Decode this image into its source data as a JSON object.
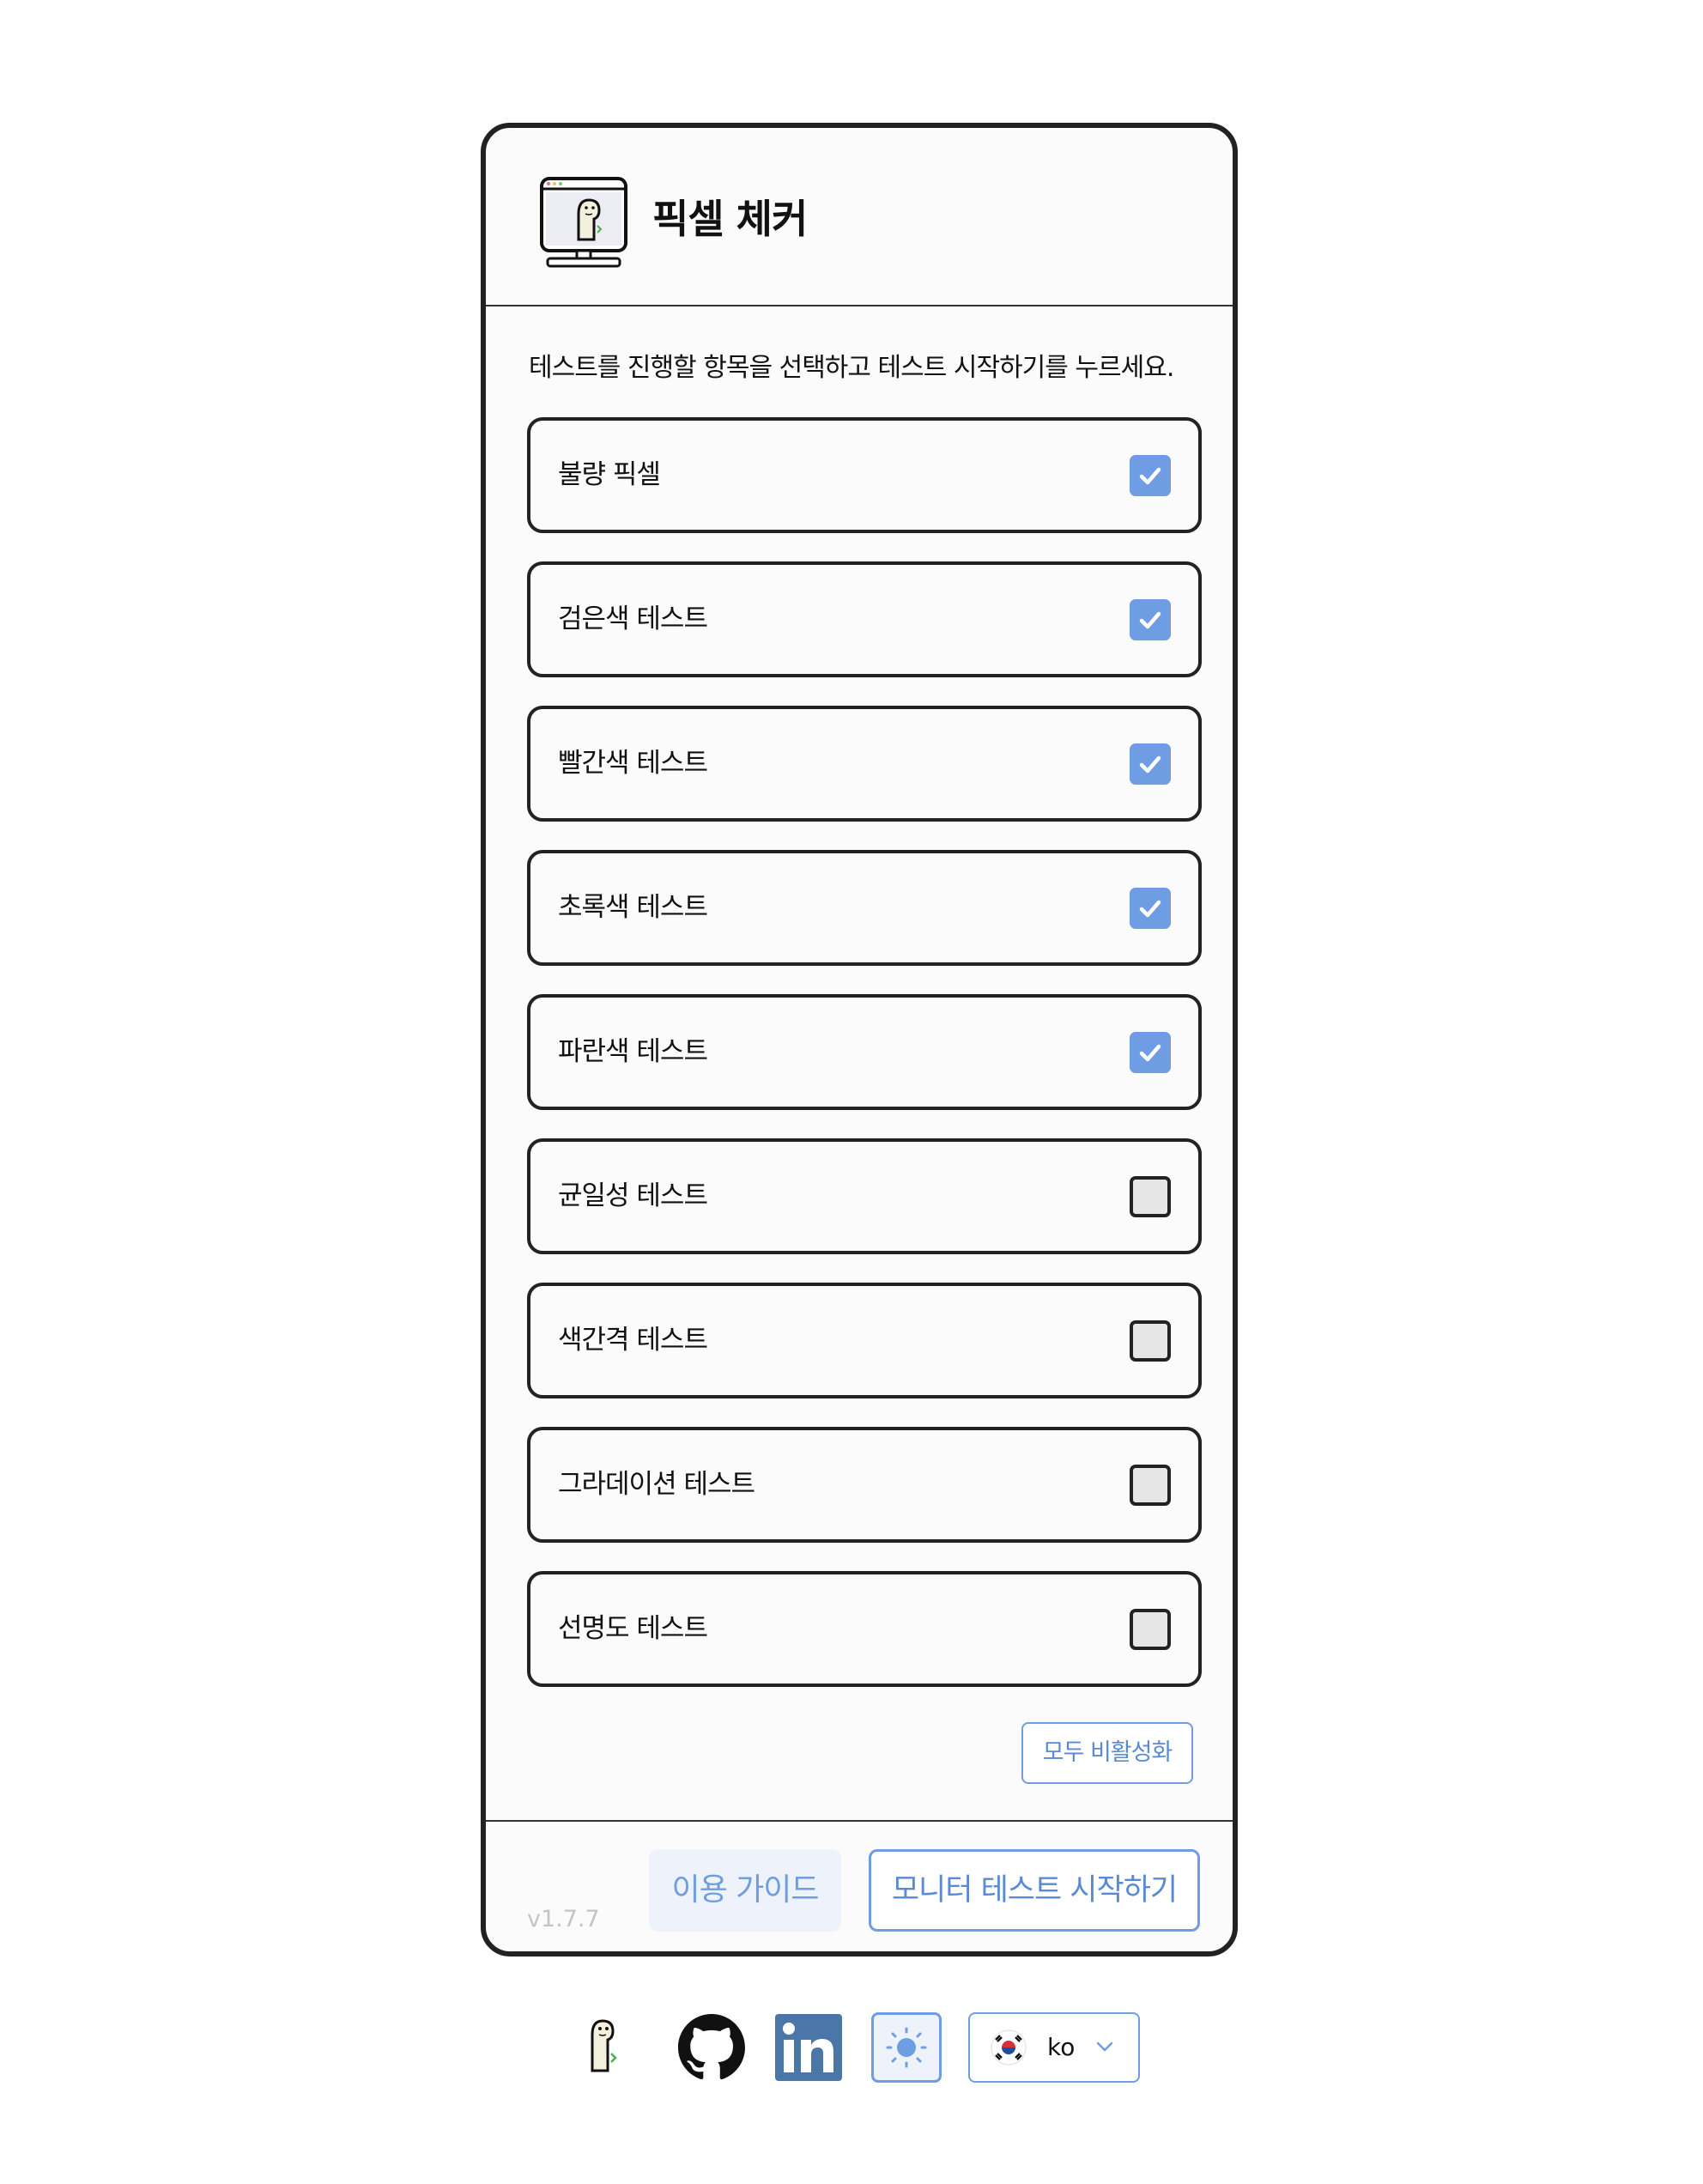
{
  "app": {
    "title": "픽셀 체커",
    "version": "v1.7.7"
  },
  "instruction": "테스트를 진행할 항목을 선택하고 테스트 시작하기를 누르세요.",
  "tests": [
    {
      "label": "불량 픽셀",
      "checked": true
    },
    {
      "label": "검은색 테스트",
      "checked": true
    },
    {
      "label": "빨간색 테스트",
      "checked": true
    },
    {
      "label": "초록색 테스트",
      "checked": true
    },
    {
      "label": "파란색 테스트",
      "checked": true
    },
    {
      "label": "균일성 테스트",
      "checked": false
    },
    {
      "label": "색간격 테스트",
      "checked": false
    },
    {
      "label": "그라데이션 테스트",
      "checked": false
    },
    {
      "label": "선명도 테스트",
      "checked": false
    }
  ],
  "actions": {
    "disable_all": "모두 비활성화",
    "guide": "이용 가이드",
    "start": "모니터 테스트 시작하기"
  },
  "bottom_bar": {
    "icons": [
      "mascot-icon",
      "github-icon",
      "linkedin-icon",
      "sun-icon"
    ],
    "language": {
      "selected": "ko",
      "flag": "kr-flag-icon"
    }
  },
  "colors": {
    "accent": "#6f9de3",
    "accent_light": "#eef3fb",
    "border": "#222222",
    "unchecked": "#e6e6e6",
    "linkedin": "#4a76a8"
  }
}
